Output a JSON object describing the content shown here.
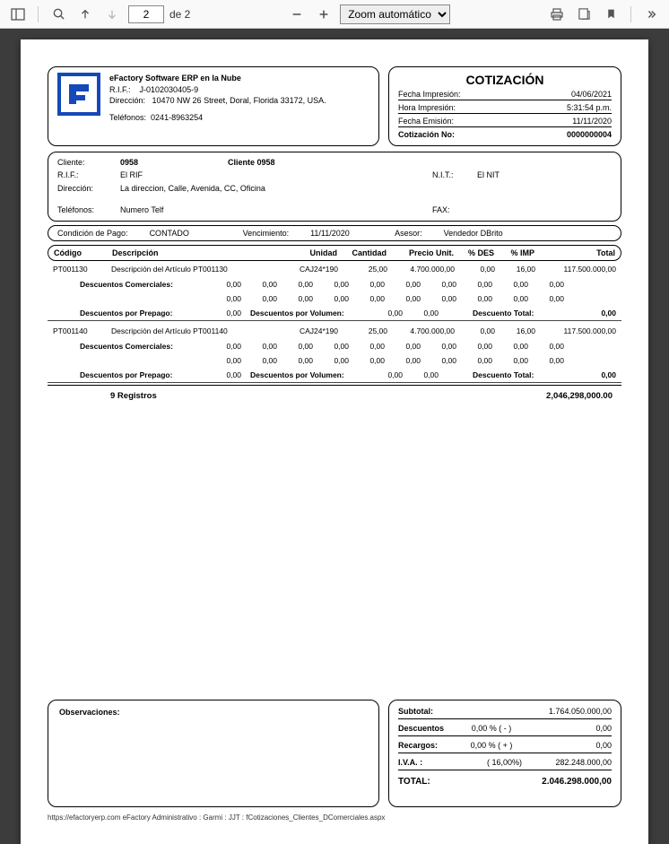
{
  "toolbar": {
    "page_current": "2",
    "page_label": "de 2",
    "zoom_label": "Zoom automático"
  },
  "company": {
    "name": "eFactory Software ERP en la Nube",
    "rif_label": "R.I.F.:",
    "rif": "J-0102030405-9",
    "dir_label": "Dirección:",
    "dir": "10470 NW 26 Street, Doral, Florida 33172, USA.",
    "tel_label": "Teléfonos:",
    "tel": "0241-8963254"
  },
  "meta": {
    "title": "COTIZACIÓN",
    "fecha_imp_lbl": "Fecha Impresión:",
    "fecha_imp": "04/06/2021",
    "hora_imp_lbl": "Hora Impresión:",
    "hora_imp": "5:31:54 p.m.",
    "fecha_emi_lbl": "Fecha Emisión:",
    "fecha_emi": "11/11/2020",
    "cot_no_lbl": "Cotización No:",
    "cot_no": "0000000004"
  },
  "client": {
    "cliente_lbl": "Cliente:",
    "cliente_cod": "0958",
    "cliente_name": "Cliente 0958",
    "rif_lbl": "R.I.F.:",
    "rif": "El RIF",
    "nit_lbl": "N.I.T.:",
    "nit": "El NIT",
    "dir_lbl": "Dirección:",
    "dir": "La direccion, Calle, Avenida, CC, Oficina",
    "tel_lbl": "Teléfonos:",
    "tel": "Numero Telf",
    "fax_lbl": "FAX:",
    "fax": ""
  },
  "cond": {
    "cond_lbl": "Condición de Pago:",
    "cond": "CONTADO",
    "venc_lbl": "Vencimiento:",
    "venc": "11/11/2020",
    "asesor_lbl": "Asesor:",
    "asesor": "Vendedor DBrito"
  },
  "headers": {
    "codigo": "Código",
    "desc": "Descripción",
    "unidad": "Unidad",
    "cantidad": "Cantidad",
    "precio": "Precio Unit.",
    "des": "% DES",
    "imp": "% IMP",
    "total": "Total"
  },
  "lines": [
    {
      "codigo": "PT001130",
      "desc": "Descripción del Artículo PT001130",
      "unidad": "CAJ24*190",
      "cantidad": "25,00",
      "precio": "4.700.000,00",
      "des": "0,00",
      "imp": "16,00",
      "total": "117.500.000,00"
    },
    {
      "codigo": "PT001140",
      "desc": "Descripción del Artículo PT001140",
      "unidad": "CAJ24*190",
      "cantidad": "25,00",
      "precio": "4.700.000,00",
      "des": "0,00",
      "imp": "16,00",
      "total": "117.500.000,00"
    }
  ],
  "disc": {
    "com_lbl": "Descuentos Comerciales:",
    "prep_lbl": "Descuentos por Prepago:",
    "vol_lbl": "Descuentos por Volumen:",
    "tot_lbl": "Descuento Total:",
    "zero": "0,00"
  },
  "summary": {
    "reg_lbl": "9 Registros",
    "reg_total": "2,046,298,000.00"
  },
  "obs": {
    "title": "Observaciones:"
  },
  "totals": {
    "subtotal_lbl": "Subtotal:",
    "subtotal": "1.764.050.000,00",
    "desc_lbl": "Descuentos",
    "desc_mid": "0,00    % ( - )",
    "desc_val": "0,00",
    "rec_lbl": "Recargos:",
    "rec_mid": "0,00    % ( + )",
    "rec_val": "0,00",
    "iva_lbl": "I.V.A.  :",
    "iva_mid": "( 16,00%)",
    "iva_val": "282.248.000,00",
    "total_lbl": "TOTAL:",
    "total_val": "2.046.298.000,00"
  },
  "footer": {
    "text": "https://efactoryerp.com        eFactory Administrativo  :  Garmi  :  JJT  :  fCotizaciones_Clientes_DComerciales.aspx"
  }
}
